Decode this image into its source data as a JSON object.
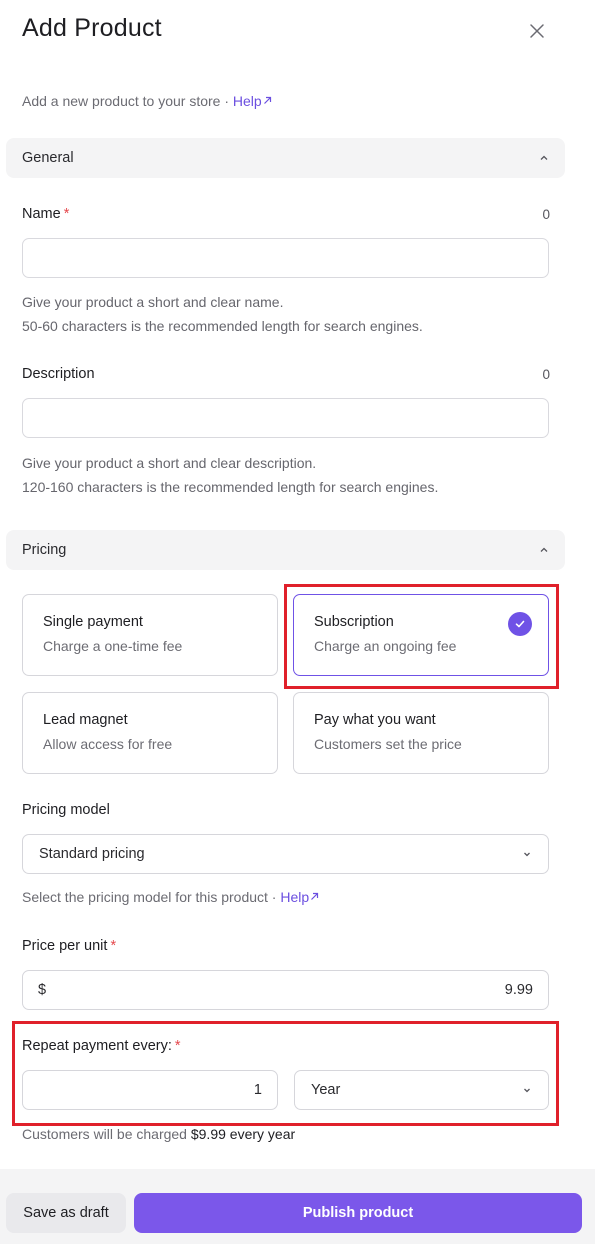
{
  "header": {
    "title": "Add Product",
    "subtitle": "Add a new product to your store ·",
    "help_label": "Help"
  },
  "general": {
    "section_label": "General",
    "name": {
      "label": "Name",
      "required_mark": "*",
      "counter": "0",
      "value": "",
      "hint_line1": "Give your product a short and clear name.",
      "hint_line2": "50-60 characters is the recommended length for search engines."
    },
    "description": {
      "label": "Description",
      "counter": "0",
      "value": "",
      "hint_line1": "Give your product a short and clear description.",
      "hint_line2": "120-160 characters is the recommended length for search engines."
    }
  },
  "pricing": {
    "section_label": "Pricing",
    "options": [
      {
        "title": "Single payment",
        "desc": "Charge a one-time fee"
      },
      {
        "title": "Subscription",
        "desc": "Charge an ongoing fee"
      },
      {
        "title": "Lead magnet",
        "desc": "Allow access for free"
      },
      {
        "title": "Pay what you want",
        "desc": "Customers set the price"
      }
    ],
    "selected_option": "Subscription",
    "pricing_model": {
      "label": "Pricing model",
      "value": "Standard pricing",
      "hint": "Select the pricing model for this product ·",
      "help_label": "Help"
    },
    "price_per_unit": {
      "label": "Price per unit",
      "required_mark": "*",
      "currency": "$",
      "value": "9.99"
    },
    "repeat": {
      "label": "Repeat payment every:",
      "required_mark": "*",
      "interval_value": "1",
      "period_value": "Year",
      "summary_prefix": "Customers will be charged",
      "summary_amount": "$9.99",
      "summary_suffix": "every year"
    }
  },
  "footer": {
    "draft_label": "Save as draft",
    "publish_label": "Publish product"
  },
  "colors": {
    "accent": "#7b57ea",
    "highlight": "#e0202a",
    "required": "#e5484d"
  },
  "icons": [
    "close-icon",
    "external-link-icon",
    "chevron-up-icon",
    "check-icon",
    "chevron-down-icon"
  ]
}
